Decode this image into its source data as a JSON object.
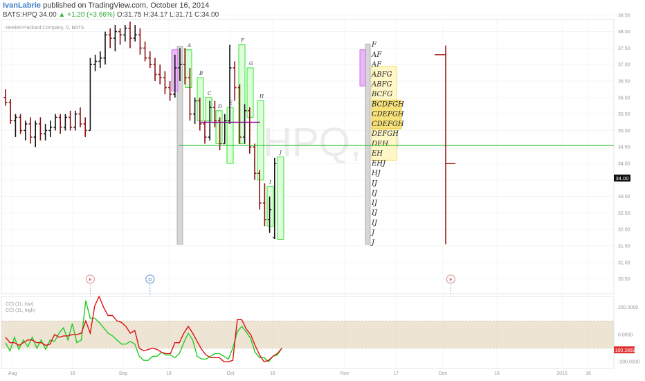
{
  "header": {
    "author": "IvanLabrie",
    "published": " published on TradingView.com, October 16, 2014",
    "symbol": "BATS:HPQ",
    "last": " 34.00 ",
    "change": "▲ +1.20 (+3.66%)",
    "ohlc": " O:31.75 H:34.17 L:31.71 C:34.00"
  },
  "colors": {
    "up": "#111111",
    "down": "#8b1010",
    "price_line": "#1fbb1f",
    "box": "#22dd22",
    "value_area": "#f5e04a",
    "initial_balance": "#cc66ee",
    "poc": "#8a0a8a",
    "cci_low": "#22cc22",
    "cci_high": "#dd1111",
    "cci_band": "#e6d9c2"
  },
  "chart_data": {
    "type": "candlestick",
    "title": "Hewlett-Packard Company, D, BATS",
    "y_main": {
      "range": [
        30.05,
        38.37
      ],
      "ticks": [
        "38.50",
        "38.00",
        "37.50",
        "37.00",
        "36.50",
        "36.00",
        "35.50",
        "35.00",
        "34.50",
        "34.00",
        "33.50",
        "33.00",
        "32.50",
        "32.00",
        "31.50",
        "31.00",
        "30.50"
      ]
    },
    "y_cci": {
      "range": [
        -250,
        280
      ],
      "ticks": [
        "200.0000",
        "0.0000",
        "-200.0000"
      ]
    },
    "x_labels": [
      "Aug",
      "16",
      "Sep",
      "16",
      "Oct",
      "16",
      "Nov",
      "17",
      "Dec",
      "16",
      "2015",
      "16"
    ],
    "last_price_label": "34.00",
    "cci_value_label": "-100.2869",
    "bars": [
      {
        "o": 36.0,
        "h": 36.25,
        "l": 35.75,
        "c": 35.85
      },
      {
        "o": 35.85,
        "h": 35.95,
        "l": 35.2,
        "c": 35.3
      },
      {
        "o": 35.3,
        "h": 35.5,
        "l": 34.8,
        "c": 35.4
      },
      {
        "o": 35.4,
        "h": 35.5,
        "l": 34.9,
        "c": 35.0
      },
      {
        "o": 35.0,
        "h": 35.3,
        "l": 34.7,
        "c": 35.2
      },
      {
        "o": 35.2,
        "h": 35.4,
        "l": 34.6,
        "c": 34.8
      },
      {
        "o": 34.8,
        "h": 35.3,
        "l": 34.5,
        "c": 35.2
      },
      {
        "o": 35.2,
        "h": 35.4,
        "l": 34.7,
        "c": 34.9
      },
      {
        "o": 34.9,
        "h": 35.2,
        "l": 34.7,
        "c": 35.0
      },
      {
        "o": 35.0,
        "h": 35.3,
        "l": 34.8,
        "c": 35.1
      },
      {
        "o": 35.1,
        "h": 35.5,
        "l": 35.0,
        "c": 35.4
      },
      {
        "o": 35.4,
        "h": 35.5,
        "l": 34.9,
        "c": 35.1
      },
      {
        "o": 35.1,
        "h": 35.5,
        "l": 35.0,
        "c": 35.4
      },
      {
        "o": 35.4,
        "h": 35.6,
        "l": 35.0,
        "c": 35.1
      },
      {
        "o": 35.1,
        "h": 35.6,
        "l": 35.0,
        "c": 35.5
      },
      {
        "o": 35.5,
        "h": 35.7,
        "l": 35.1,
        "c": 35.2
      },
      {
        "o": 35.2,
        "h": 35.4,
        "l": 34.8,
        "c": 35.0
      },
      {
        "o": 35.0,
        "h": 37.2,
        "l": 35.0,
        "c": 37.0
      },
      {
        "o": 37.0,
        "h": 37.3,
        "l": 36.8,
        "c": 37.1
      },
      {
        "o": 37.1,
        "h": 37.4,
        "l": 36.9,
        "c": 37.2
      },
      {
        "o": 37.2,
        "h": 38.0,
        "l": 37.0,
        "c": 37.9
      },
      {
        "o": 37.9,
        "h": 38.1,
        "l": 37.5,
        "c": 37.8
      },
      {
        "o": 37.8,
        "h": 38.2,
        "l": 37.4,
        "c": 38.0
      },
      {
        "o": 38.0,
        "h": 38.1,
        "l": 37.6,
        "c": 37.9
      },
      {
        "o": 37.9,
        "h": 38.2,
        "l": 37.7,
        "c": 38.1
      },
      {
        "o": 38.1,
        "h": 38.3,
        "l": 37.5,
        "c": 37.8
      },
      {
        "o": 37.8,
        "h": 38.2,
        "l": 37.7,
        "c": 37.9
      },
      {
        "o": 37.9,
        "h": 38.1,
        "l": 37.3,
        "c": 37.5
      },
      {
        "o": 37.5,
        "h": 37.7,
        "l": 37.1,
        "c": 37.2
      },
      {
        "o": 37.2,
        "h": 37.4,
        "l": 36.9,
        "c": 37.0
      },
      {
        "o": 37.0,
        "h": 37.2,
        "l": 36.5,
        "c": 36.7
      },
      {
        "o": 36.7,
        "h": 37.0,
        "l": 36.4,
        "c": 36.6
      },
      {
        "o": 36.6,
        "h": 36.8,
        "l": 36.1,
        "c": 36.3
      },
      {
        "o": 36.3,
        "h": 36.5,
        "l": 35.9,
        "c": 36.1
      },
      {
        "o": 36.1,
        "h": 37.3,
        "l": 36.0,
        "c": 36.9
      },
      {
        "o": 36.9,
        "h": 37.5,
        "l": 36.5,
        "c": 37.0
      },
      {
        "o": 37.0,
        "h": 37.5,
        "l": 36.4,
        "c": 36.6
      },
      {
        "o": 36.6,
        "h": 36.9,
        "l": 35.3,
        "c": 35.5
      },
      {
        "o": 35.5,
        "h": 36.0,
        "l": 35.2,
        "c": 35.9
      },
      {
        "o": 35.9,
        "h": 36.0,
        "l": 35.0,
        "c": 35.2
      },
      {
        "o": 35.2,
        "h": 35.3,
        "l": 34.6,
        "c": 34.8
      },
      {
        "o": 34.8,
        "h": 35.9,
        "l": 34.7,
        "c": 35.7
      },
      {
        "o": 35.7,
        "h": 35.9,
        "l": 35.1,
        "c": 35.3
      },
      {
        "o": 35.3,
        "h": 35.4,
        "l": 34.4,
        "c": 34.6
      },
      {
        "o": 34.6,
        "h": 35.5,
        "l": 34.6,
        "c": 35.3
      },
      {
        "o": 35.3,
        "h": 37.6,
        "l": 35.2,
        "c": 36.9
      },
      {
        "o": 36.9,
        "h": 37.1,
        "l": 35.9,
        "c": 36.3
      },
      {
        "o": 36.3,
        "h": 36.4,
        "l": 34.6,
        "c": 34.8
      },
      {
        "o": 34.8,
        "h": 35.8,
        "l": 34.6,
        "c": 35.6
      },
      {
        "o": 35.6,
        "h": 35.7,
        "l": 34.3,
        "c": 34.5
      },
      {
        "o": 34.5,
        "h": 34.6,
        "l": 33.5,
        "c": 33.7
      },
      {
        "o": 33.7,
        "h": 33.8,
        "l": 32.6,
        "c": 32.8
      },
      {
        "o": 32.8,
        "h": 33.4,
        "l": 32.1,
        "c": 32.3
      },
      {
        "o": 32.3,
        "h": 33.0,
        "l": 31.9,
        "c": 32.6
      },
      {
        "o": 31.75,
        "h": 34.17,
        "l": 31.71,
        "c": 34.0
      }
    ],
    "markers": [
      {
        "label": "E",
        "bar": 17
      },
      {
        "label": "D",
        "bar": 29
      },
      {
        "label": "E",
        "bar": 92
      }
    ],
    "box_letters": [
      "A",
      "B",
      "C",
      "D",
      "E",
      "F",
      "G",
      "H",
      "I",
      "J"
    ],
    "profile_rows": [
      "F",
      "AF",
      "AF",
      "ABFG",
      "ABFG",
      "BCFG",
      "BCDFGH",
      "CDEFGH",
      "CDEFGH",
      "DEFGH",
      "DEH",
      "EH",
      "EHJ",
      "HJ",
      "IJ",
      "IJ",
      "IJ",
      "IJ",
      "IJ",
      "J",
      "J"
    ],
    "cci_low": [
      -60,
      -120,
      -20,
      -110,
      -40,
      -90,
      -20,
      -100,
      -40,
      -110,
      -40,
      -50,
      10,
      50,
      -40,
      80,
      -60,
      -40,
      250,
      120,
      120,
      90,
      50,
      10,
      -10,
      -40,
      -70,
      -70,
      -50,
      -70,
      -160,
      -190,
      -190,
      -160,
      -160,
      -130,
      -150,
      -150,
      -170,
      -140,
      -60,
      10,
      -40,
      -160,
      -180,
      -180,
      -160,
      -140,
      -140,
      -160,
      -180,
      -100,
      20,
      60,
      20,
      -30,
      -130,
      -170,
      -170,
      -200,
      -160,
      -150,
      -100
    ],
    "cci_high": [
      -20,
      -60,
      -60,
      -80,
      -60,
      -40,
      -40,
      -60,
      -60,
      -80,
      -70,
      0,
      -20,
      -10,
      -10,
      0,
      0,
      10,
      100,
      10,
      210,
      280,
      200,
      140,
      140,
      100,
      90,
      60,
      10,
      30,
      -100,
      -120,
      -110,
      -100,
      -110,
      -130,
      -140,
      -140,
      -60,
      -60,
      10,
      60,
      10,
      -50,
      -110,
      -150,
      -170,
      -170,
      -170,
      -200,
      -200,
      -190,
      110,
      110,
      40,
      0,
      -80,
      -150,
      -200,
      -190,
      -160,
      -140,
      -100
    ],
    "legend": [
      "CCI (11, low)",
      "CCI (11, high)"
    ],
    "poc": 35.25,
    "green_line": 34.55
  }
}
